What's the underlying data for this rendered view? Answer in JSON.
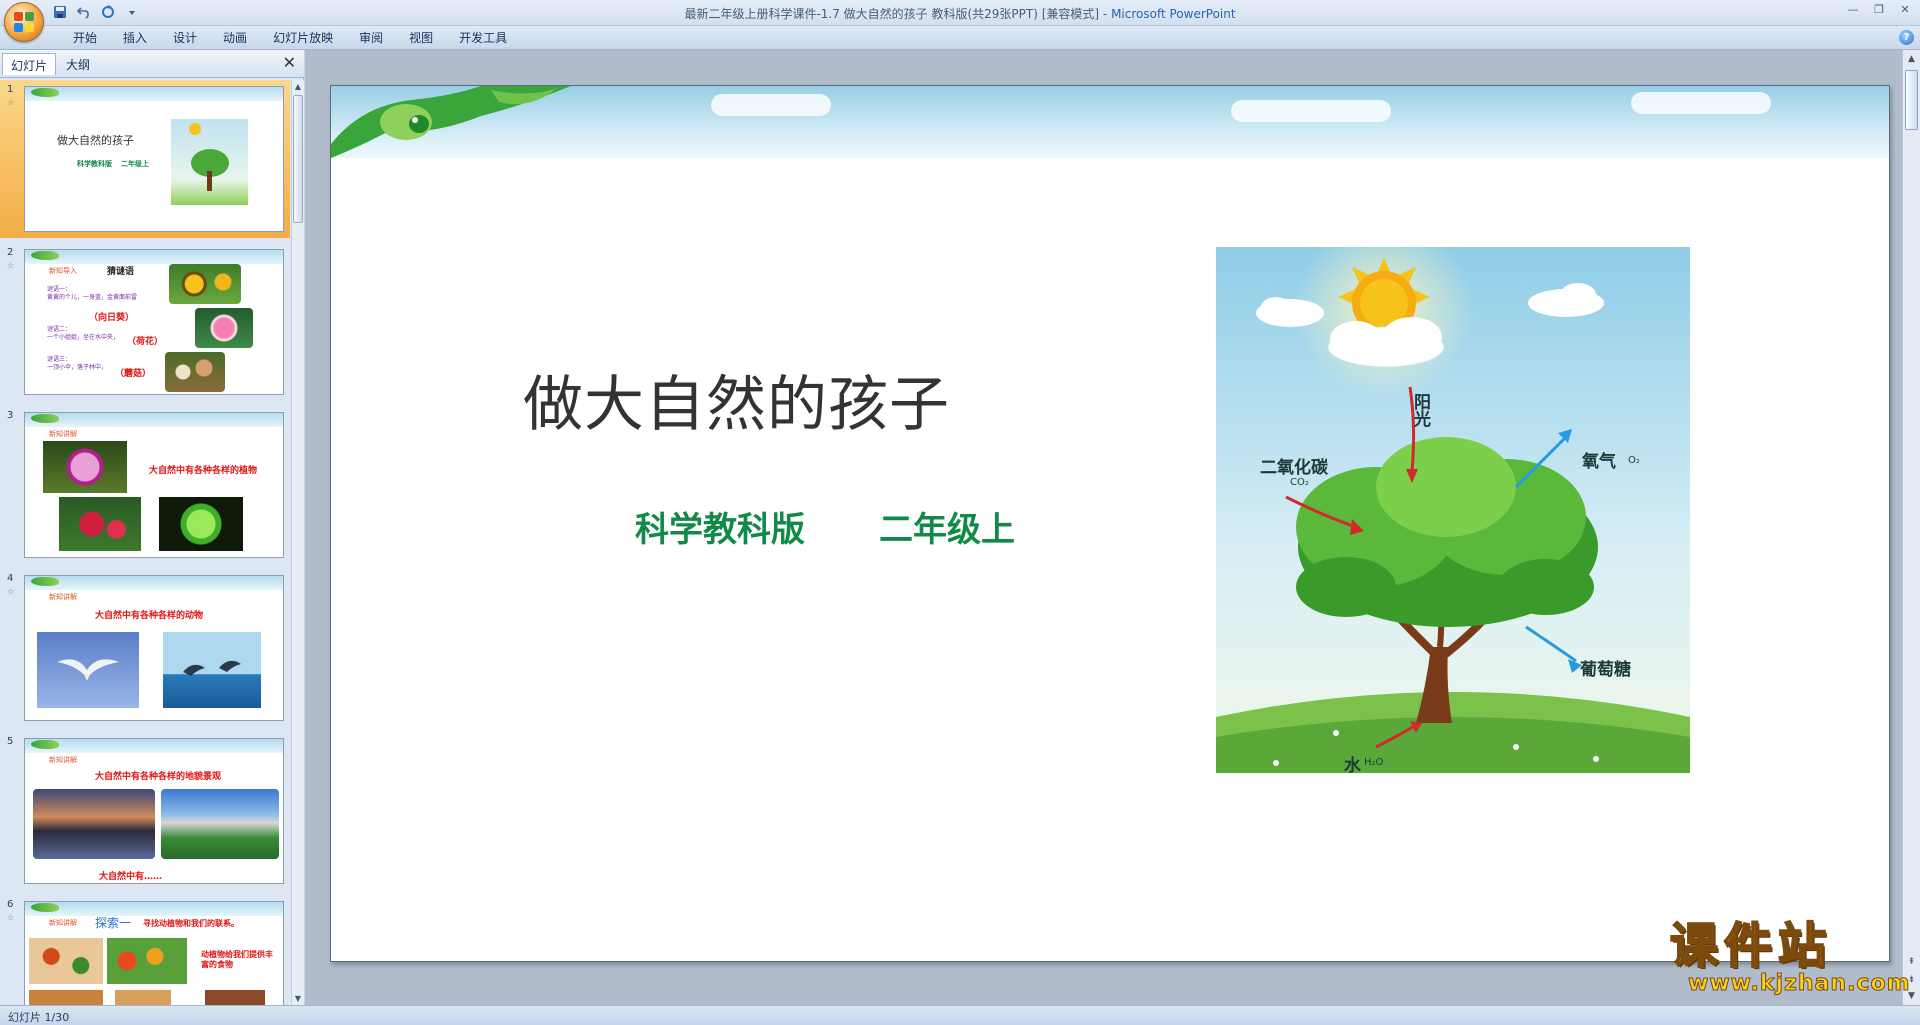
{
  "window": {
    "title": "最新二年级上册科学课件-1.7 做大自然的孩子 教科版(共29张PPT) [兼容模式] - ",
    "app_name": "Microsoft PowerPoint"
  },
  "ribbon": {
    "tabs": [
      "开始",
      "插入",
      "设计",
      "动画",
      "幻灯片放映",
      "审阅",
      "视图",
      "开发工具"
    ],
    "help": "?"
  },
  "panel": {
    "tabs": [
      "幻灯片",
      "大纲"
    ],
    "close": "✕"
  },
  "thumbnails": [
    {
      "num": "1",
      "title": "做大自然的孩子",
      "sub1": "科学教科版",
      "sub2": "二年级上"
    },
    {
      "num": "2",
      "label": "新知导入",
      "heading": "猜谜语",
      "riddles": [
        "谜语一：",
        "黄黄的个儿，一身蓝，金黄面前雷",
        "谜语二：",
        "一个小姐姐，坐在水中央，",
        "谜语三：",
        "一顶小伞，落子林中，"
      ],
      "answers": [
        "（向日葵）",
        "（荷花）",
        "（蘑菇）"
      ]
    },
    {
      "num": "3",
      "label": "新知讲解",
      "caption": "大自然中有各种各样的植物"
    },
    {
      "num": "4",
      "label": "新知讲解",
      "caption": "大自然中有各种各样的动物"
    },
    {
      "num": "5",
      "label": "新知讲解",
      "caption": "大自然中有各种各样的地貌景观",
      "bottom": "大自然中有……"
    },
    {
      "num": "6",
      "label": "新知讲解",
      "heading": "探索一",
      "caption": "寻找动植物和我们的联系。",
      "note": "动植物给我们提供丰富的食物"
    }
  ],
  "slide": {
    "title": "做大自然的孩子",
    "subtitle_left": "科学教科版",
    "subtitle_right": "二年级上",
    "diagram_labels": {
      "sun": "阳光",
      "co2": "二氧化碳",
      "co2_formula": "CO₂",
      "o2": "氧气",
      "o2_formula": "O₂",
      "glucose": "葡萄糖",
      "water": "水",
      "water_formula": "H₂O"
    }
  },
  "watermark": {
    "main": "课件站",
    "url": "www.kjzhan.com"
  },
  "status": {
    "slide_counter": "幻灯片 1/30"
  },
  "colors": {
    "accent_green": "#118a48",
    "selection_orange": "#f3ad45",
    "title_gray": "#333333"
  }
}
